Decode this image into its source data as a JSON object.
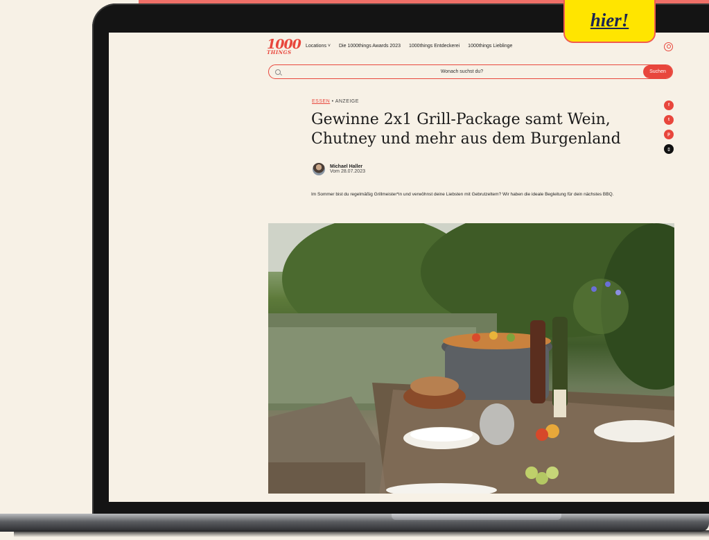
{
  "cta": {
    "label": "hier!"
  },
  "site": {
    "logo": {
      "number": "1000",
      "word": "THINGS"
    },
    "nav": [
      {
        "label": "Locations ˅"
      },
      {
        "label": "Die 1000things Awards 2023"
      },
      {
        "label": "1000things Entdeckerei"
      },
      {
        "label": "1000things Lieblinge"
      }
    ],
    "search": {
      "placeholder": "Wonach suchst du?",
      "button": "Suchen"
    }
  },
  "article": {
    "category": "ESSEN",
    "tag": " • ANZEIGE",
    "title": "Gewinne 2x1 Grill-Package samt Wein, Chutney und mehr aus dem Burgenland",
    "author": {
      "name": "Michael Haller",
      "date": "Vom 28.07.2023"
    },
    "lead": "Im Sommer bist du regelmäßig Grillmeister*in und verwöhnst deine Liebsten mit Gebrutzeltem? Wir haben die ideale Begleitung für dein nächstes BBQ.",
    "share": [
      {
        "icon": "facebook-icon",
        "glyph": "f"
      },
      {
        "icon": "twitter-icon",
        "glyph": "t"
      },
      {
        "icon": "pinterest-icon",
        "glyph": "p"
      },
      {
        "icon": "bookmark-icon",
        "glyph": "▯"
      }
    ]
  },
  "colors": {
    "accent": "#e8463c",
    "background": "#f7f1e6",
    "badge": "#ffe500"
  }
}
